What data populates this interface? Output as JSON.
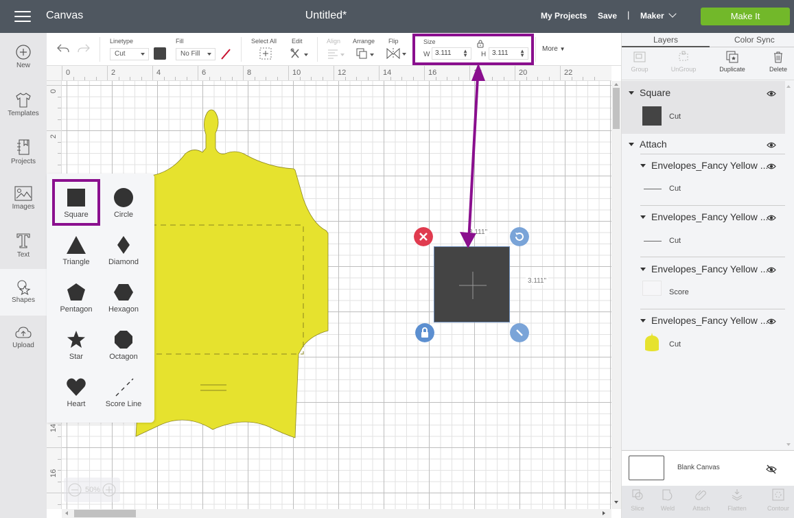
{
  "topbar": {
    "app_title": "Canvas",
    "doc_title": "Untitled*",
    "my_projects": "My Projects",
    "save": "Save",
    "separator": "|",
    "machine": "Maker",
    "make_it": "Make It",
    "make_it_color": "#72b82a"
  },
  "leftnav": {
    "items": [
      {
        "label": "New",
        "icon": "plus-circle-icon"
      },
      {
        "label": "Templates",
        "icon": "tshirt-icon"
      },
      {
        "label": "Projects",
        "icon": "notebook-icon"
      },
      {
        "label": "Images",
        "icon": "image-icon"
      },
      {
        "label": "Text",
        "icon": "text-t-icon"
      },
      {
        "label": "Shapes",
        "icon": "shapes-icon",
        "active": true
      },
      {
        "label": "Upload",
        "icon": "cloud-upload-icon"
      }
    ]
  },
  "toolbar": {
    "linetype_label": "Linetype",
    "linetype_value": "Cut",
    "linetype_color": "#444444",
    "fill_label": "Fill",
    "fill_value": "No Fill",
    "select_all_label": "Select All",
    "edit_label": "Edit",
    "align_label": "Align",
    "arrange_label": "Arrange",
    "flip_label": "Flip",
    "size_label": "Size",
    "width_label": "W",
    "width_value": "3.111",
    "height_label": "H",
    "height_value": "3.111",
    "more_label": "More"
  },
  "ruler": {
    "top": [
      "0",
      "2",
      "4",
      "6",
      "8",
      "10",
      "12",
      "14",
      "16",
      "18",
      "20",
      "22"
    ],
    "left": [
      "0",
      "2",
      "14",
      "16"
    ]
  },
  "shapes_panel": {
    "items": [
      {
        "label": "Square",
        "selected": true
      },
      {
        "label": "Circle"
      },
      {
        "label": "Triangle"
      },
      {
        "label": "Diamond"
      },
      {
        "label": "Pentagon"
      },
      {
        "label": "Hexagon"
      },
      {
        "label": "Star"
      },
      {
        "label": "Octagon"
      },
      {
        "label": "Heart"
      },
      {
        "label": "Score Line"
      }
    ]
  },
  "canvas": {
    "envelope_color": "#e6e22e",
    "selected_width_label": "3.111\"",
    "selected_height_label": "3.111\"",
    "zoom_level": "50%",
    "highlight_color": "#8a0f8e"
  },
  "right_panel": {
    "tabs": [
      "Layers",
      "Color Sync"
    ],
    "actions": [
      {
        "label": "Group",
        "enabled": false
      },
      {
        "label": "UnGroup",
        "enabled": false
      },
      {
        "label": "Duplicate",
        "enabled": true
      },
      {
        "label": "Delete",
        "enabled": true
      }
    ],
    "layers": [
      {
        "name": "Square",
        "sub": "Cut",
        "swatch": "#444444",
        "selected": true
      },
      {
        "name": "Attach"
      },
      {
        "name": "Envelopes_Fancy Yellow ...",
        "sub": "Cut",
        "swatch": "line"
      },
      {
        "name": "Envelopes_Fancy Yellow ...",
        "sub": "Cut",
        "swatch": "line"
      },
      {
        "name": "Envelopes_Fancy Yellow ...",
        "sub": "Score",
        "swatch": "blank"
      },
      {
        "name": "Envelopes_Fancy Yellow ...",
        "sub": "Cut",
        "swatch": "#e6e22e"
      }
    ],
    "blank_canvas": "Blank Canvas",
    "bottom_actions": [
      "Slice",
      "Weld",
      "Attach",
      "Flatten",
      "Contour"
    ]
  }
}
